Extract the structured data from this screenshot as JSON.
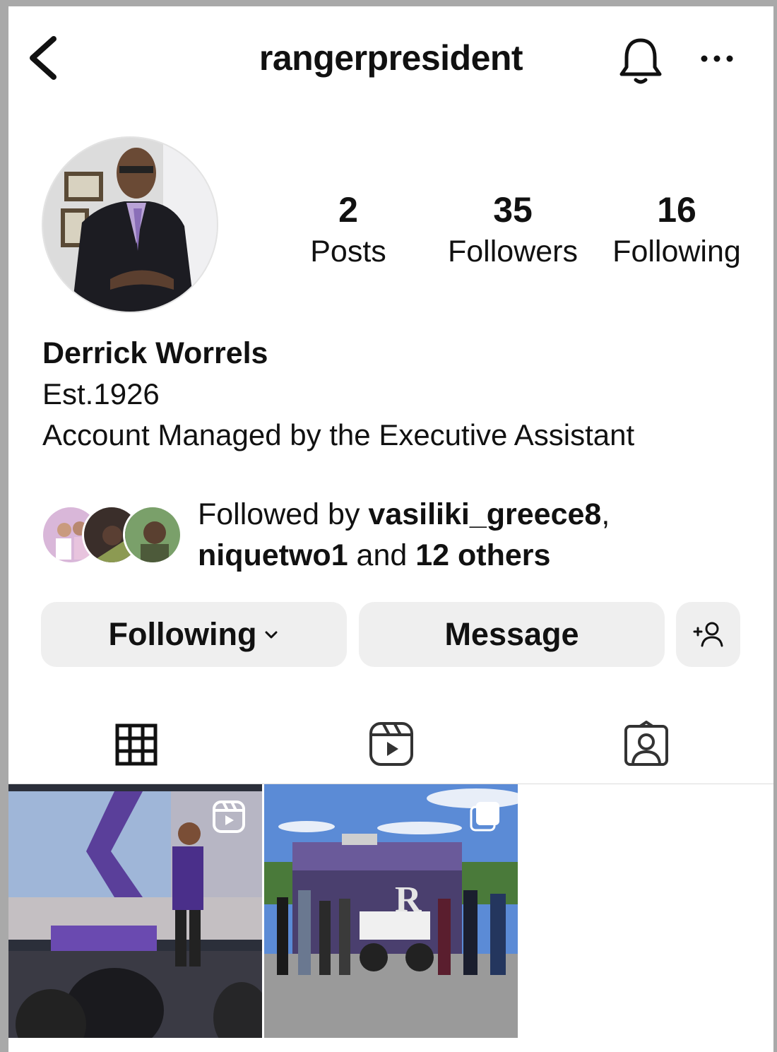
{
  "header": {
    "username": "rangerpresident"
  },
  "profile": {
    "stats": [
      {
        "value": "2",
        "label": "Posts"
      },
      {
        "value": "35",
        "label": "Followers"
      },
      {
        "value": "16",
        "label": "Following"
      }
    ],
    "name": "Derrick Worrels",
    "bio_line1": "Est.1926",
    "bio_line2": "Account Managed by the Executive Assistant"
  },
  "followed_by": {
    "prefix": "Followed by ",
    "user1": "vasiliki_greece8",
    "comma": ",",
    "user2": "niquetwo1",
    "middle": " and ",
    "others": "12 others"
  },
  "actions": {
    "following_label": "Following",
    "message_label": "Message"
  },
  "icons": {
    "back": "chevron-left-icon",
    "bell": "bell-icon",
    "more": "more-horizontal-icon",
    "add_person": "add-person-icon",
    "grid": "grid-icon",
    "reels": "reels-icon",
    "tagged": "tagged-person-icon"
  },
  "colors": {
    "button_bg": "#efefef",
    "text": "#111111"
  }
}
